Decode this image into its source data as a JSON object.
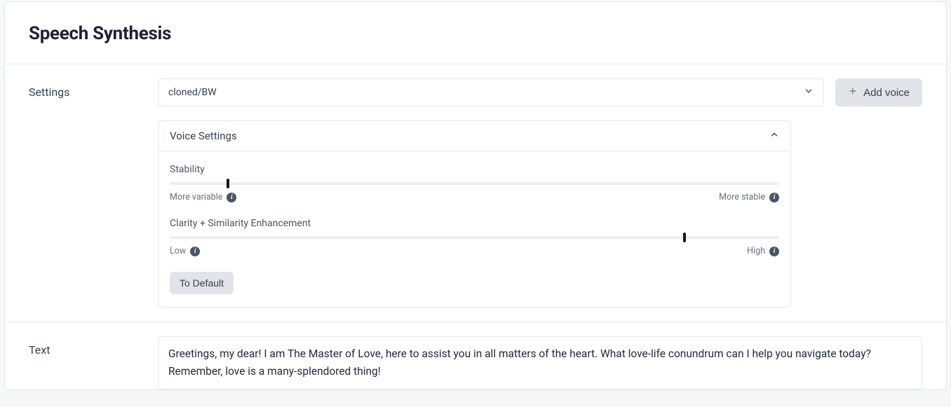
{
  "header": {
    "title": "Speech Synthesis"
  },
  "settings": {
    "label": "Settings",
    "voice_selected": "cloned/BW",
    "add_voice_label": "Add voice",
    "panel_title": "Voice Settings",
    "stability": {
      "title": "Stability",
      "value_percent": 9.5,
      "low_label": "More variable",
      "high_label": "More stable"
    },
    "clarity": {
      "title": "Clarity + Similarity Enhancement",
      "value_percent": 84.5,
      "low_label": "Low",
      "high_label": "High"
    },
    "default_button": "To Default"
  },
  "text": {
    "label": "Text",
    "value": "Greetings, my dear! I am The Master of Love, here to assist you in all matters of the heart. What love-life conundrum can I help you navigate today? Remember, love is a many-splendored thing!"
  }
}
